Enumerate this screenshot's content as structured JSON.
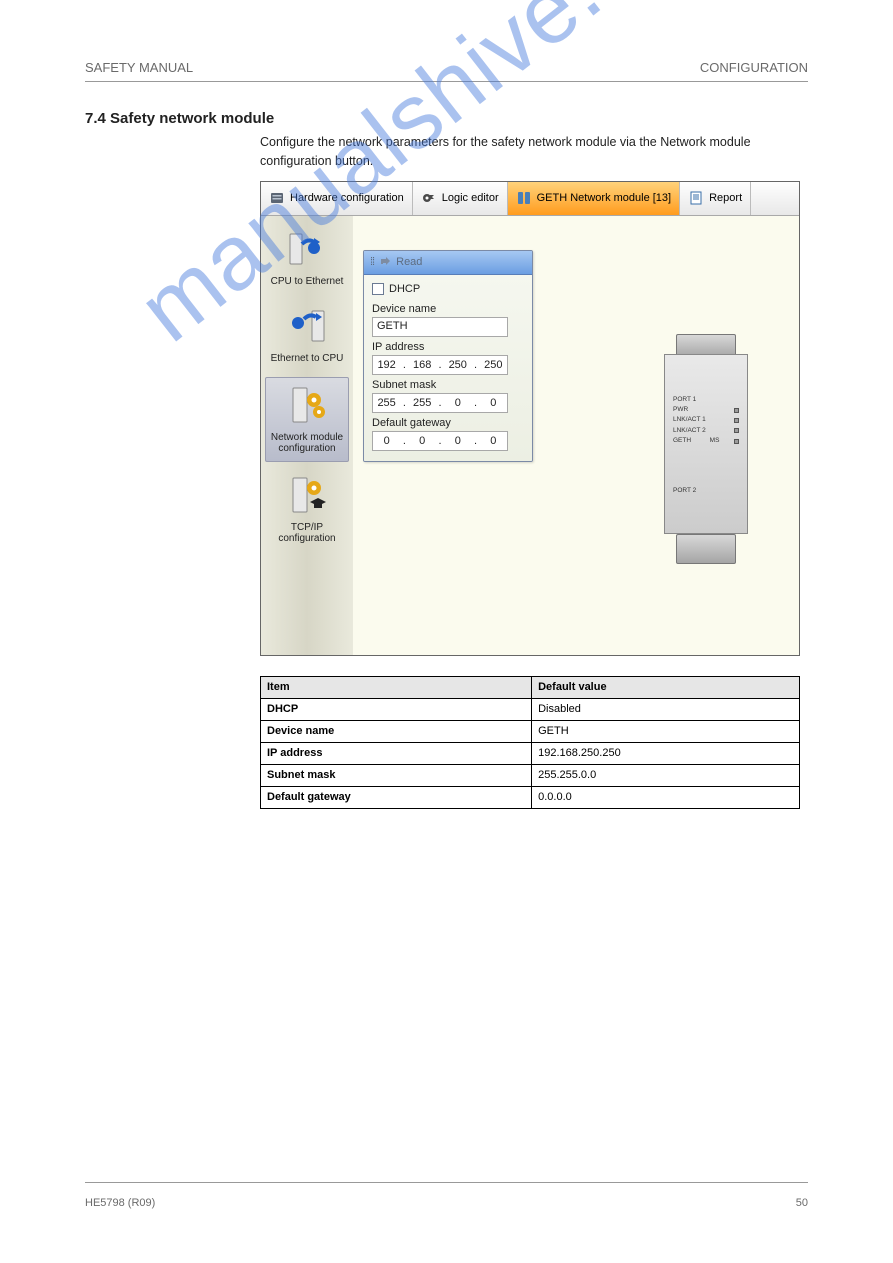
{
  "header": {
    "left": "SAFETY MANUAL",
    "right": "CONFIGURATION"
  },
  "section_title": "7.4 Safety network module",
  "intro_text": "Configure the network parameters for the safety network module via the Network module configuration button.",
  "screenshot": {
    "tabs": [
      {
        "label": "Hardware configuration",
        "active": false
      },
      {
        "label": "Logic editor",
        "active": false
      },
      {
        "label": "GETH Network module [13]",
        "active": true
      },
      {
        "label": "Report",
        "active": false
      }
    ],
    "sidebar": [
      {
        "label": "CPU to Ethernet",
        "selected": false
      },
      {
        "label": "Ethernet to CPU",
        "selected": false
      },
      {
        "label": "Network module configuration",
        "selected": true
      },
      {
        "label": "TCP/IP configuration",
        "selected": false
      }
    ],
    "panel": {
      "read_label": "Read",
      "dhcp_label": "DHCP",
      "dhcp_checked": false,
      "device_name_label": "Device name",
      "device_name_value": "GETH",
      "ip_label": "IP address",
      "ip_value": [
        "192",
        "168",
        "250",
        "250"
      ],
      "subnet_label": "Subnet mask",
      "subnet_value": [
        "255",
        "255",
        "0",
        "0"
      ],
      "gateway_label": "Default gateway",
      "gateway_value": [
        "0",
        "0",
        "0",
        "0"
      ]
    },
    "module_labels": [
      "PORT 1",
      "PWR",
      "LNK/ACT 1",
      "LNK/ACT 2",
      "GETH",
      "MS",
      "PORT 2"
    ]
  },
  "table": {
    "headers": [
      "Item",
      "Default value"
    ],
    "rows": [
      [
        "DHCP",
        "Disabled"
      ],
      [
        "Device name",
        "GETH"
      ],
      [
        "IP address",
        "192.168.250.250"
      ],
      [
        "Subnet mask",
        "255.255.0.0"
      ],
      [
        "Default gateway",
        "0.0.0.0"
      ]
    ]
  },
  "watermark": "manualshive.com",
  "footer": {
    "left": "HE5798 (R09)",
    "right": "50"
  }
}
